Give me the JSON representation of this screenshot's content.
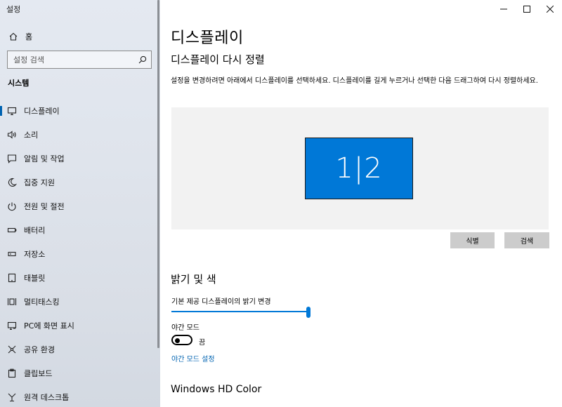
{
  "app": {
    "title": "설정"
  },
  "sidebar": {
    "home_label": "홈",
    "search_placeholder": "설정 검색",
    "section_title": "시스템",
    "items": [
      {
        "label": "디스플레이",
        "icon": "monitor-icon",
        "active": true
      },
      {
        "label": "소리",
        "icon": "speaker-icon"
      },
      {
        "label": "알림 및 작업",
        "icon": "notification-icon"
      },
      {
        "label": "집중 지원",
        "icon": "moon-icon"
      },
      {
        "label": "전원 및 절전",
        "icon": "power-icon"
      },
      {
        "label": "배터리",
        "icon": "battery-icon"
      },
      {
        "label": "저장소",
        "icon": "storage-icon"
      },
      {
        "label": "태블릿",
        "icon": "tablet-icon"
      },
      {
        "label": "멀티태스킹",
        "icon": "multitasking-icon"
      },
      {
        "label": "PC에 화면 표시",
        "icon": "project-icon"
      },
      {
        "label": "공유 환경",
        "icon": "shared-experiences-icon"
      },
      {
        "label": "클립보드",
        "icon": "clipboard-icon"
      },
      {
        "label": "원격 데스크톱",
        "icon": "remote-desktop-icon"
      }
    ]
  },
  "main": {
    "page_title": "디스플레이",
    "arrange": {
      "heading": "디스플레이 다시 정렬",
      "description": "설정을 변경하려면 아래에서 디스플레이를 선택하세요. 디스플레이를 길게 누르거나 선택한 다음 드래그하여 다시 정렬하세요.",
      "monitor_label": "1|2",
      "identify_button": "식별",
      "detect_button": "검색"
    },
    "brightness": {
      "heading": "밝기 및 색",
      "slider_label": "기본 제공 디스플레이의 밝기 변경",
      "slider_value_percent": 100,
      "night_light_label": "야간 모드",
      "night_light_state": "끔",
      "night_light_settings_link": "야간 모드 설정"
    },
    "hdr_heading": "Windows HD Color"
  },
  "colors": {
    "accent": "#0078d7",
    "link": "#0063b1"
  }
}
